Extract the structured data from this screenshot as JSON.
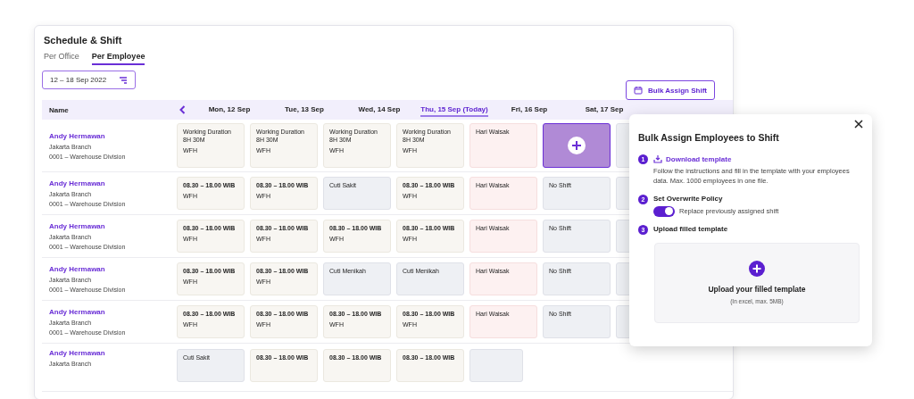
{
  "page": {
    "title": "Schedule & Shift"
  },
  "tabs": [
    {
      "label": "Per Office",
      "selected": false
    },
    {
      "label": "Per Employee",
      "selected": true
    }
  ],
  "date_filter": {
    "value": "12 – 18 Sep 2022"
  },
  "bulk_button": {
    "label": "Bulk Assign Shift"
  },
  "table": {
    "name_header": "Name",
    "days": [
      {
        "label": "Mon, 12 Sep",
        "selected": false
      },
      {
        "label": "Tue, 13 Sep",
        "selected": false
      },
      {
        "label": "Wed, 14 Sep",
        "selected": false
      },
      {
        "label": "Thu, 15 Sep (Today)",
        "selected": true
      },
      {
        "label": "Fri, 16 Sep",
        "selected": false
      },
      {
        "label": "Sat, 17 Sep",
        "selected": false
      }
    ],
    "rows": [
      {
        "name": "Andy Hermawan",
        "branch": "Jakarta Branch",
        "division": "0001 – Warehouse Division",
        "cells": [
          {
            "kind": "duration",
            "title": "Working Duration",
            "value": "8H 30M",
            "note": "WFH"
          },
          {
            "kind": "duration",
            "title": "Working Duration",
            "value": "8H 30M",
            "note": "WFH"
          },
          {
            "kind": "duration",
            "title": "Working Duration",
            "value": "8H 30M",
            "note": "WFH"
          },
          {
            "kind": "duration",
            "title": "Working Duration",
            "value": "8H 30M",
            "note": "WFH"
          },
          {
            "kind": "holiday",
            "title": "Hari Waisak"
          },
          {
            "kind": "add"
          }
        ]
      },
      {
        "name": "Andy Hermawan",
        "branch": "Jakarta Branch",
        "division": "0001 – Warehouse Division",
        "cells": [
          {
            "kind": "time",
            "title": "08.30 – 18.00 WIB",
            "note": "WFH"
          },
          {
            "kind": "time",
            "title": "08.30 – 18.00 WIB",
            "note": "WFH"
          },
          {
            "kind": "leave",
            "title": "Cuti Sakit"
          },
          {
            "kind": "time",
            "title": "08.30 – 18.00 WIB",
            "note": "WFH"
          },
          {
            "kind": "holiday",
            "title": "Hari Waisak"
          },
          {
            "kind": "noshift",
            "title": "No Shift"
          }
        ]
      },
      {
        "name": "Andy Hermawan",
        "branch": "Jakarta Branch",
        "division": "0001 – Warehouse Division",
        "cells": [
          {
            "kind": "time",
            "title": "08.30 – 18.00 WIB",
            "note": "WFH"
          },
          {
            "kind": "time",
            "title": "08.30 – 18.00 WIB",
            "note": "WFH"
          },
          {
            "kind": "time",
            "title": "08.30 – 18.00 WIB",
            "note": "WFH"
          },
          {
            "kind": "time",
            "title": "08.30 – 18.00 WIB",
            "note": "WFH"
          },
          {
            "kind": "holiday",
            "title": "Hari Waisak"
          },
          {
            "kind": "noshift",
            "title": "No Shift"
          }
        ]
      },
      {
        "name": "Andy Hermawan",
        "branch": "Jakarta Branch",
        "division": "0001 – Warehouse Division",
        "cells": [
          {
            "kind": "time",
            "title": "08.30 – 18.00 WIB",
            "note": "WFH"
          },
          {
            "kind": "time",
            "title": "08.30 – 18.00 WIB",
            "note": "WFH"
          },
          {
            "kind": "leave",
            "title": "Cuti Menikah"
          },
          {
            "kind": "leave",
            "title": "Cuti Menikah"
          },
          {
            "kind": "holiday",
            "title": "Hari Waisak"
          },
          {
            "kind": "noshift",
            "title": "No Shift"
          }
        ]
      },
      {
        "name": "Andy Hermawan",
        "branch": "Jakarta Branch",
        "division": "0001 – Warehouse Division",
        "cells": [
          {
            "kind": "time",
            "title": "08.30 – 18.00 WIB",
            "note": "WFH"
          },
          {
            "kind": "time",
            "title": "08.30 – 18.00 WIB",
            "note": "WFH"
          },
          {
            "kind": "time",
            "title": "08.30 – 18.00 WIB",
            "note": "WFH"
          },
          {
            "kind": "time",
            "title": "08.30 – 18.00 WIB",
            "note": "WFH"
          },
          {
            "kind": "holiday",
            "title": "Hari Waisak"
          },
          {
            "kind": "noshift",
            "title": "No Shift"
          }
        ]
      },
      {
        "name": "Andy Hermawan",
        "branch": "Jakarta Branch",
        "cells": [
          {
            "kind": "leave",
            "title": "Cuti Sakit"
          },
          {
            "kind": "time",
            "title": "08.30 – 18.00 WIB"
          },
          {
            "kind": "time",
            "title": "08.30 – 18.00 WIB"
          },
          {
            "kind": "time",
            "title": "08.30 – 18.00 WIB"
          }
        ]
      }
    ]
  },
  "dialog": {
    "title": "Bulk Assign Employees to Shift",
    "step_1": {
      "number": "1",
      "link": "Download template",
      "text": "Follow the instructions and fill in the template with your employees data. Max. 1000 employees in one file."
    },
    "step_2": {
      "number": "2",
      "label": "Set Overwrite Policy",
      "toggle": {
        "on": true,
        "label": "Replace previously assigned shift"
      }
    },
    "step_3": {
      "number": "3",
      "label": "Upload filled template"
    },
    "upload": {
      "title": "Upload your filled template",
      "hint": "(In excel, max. 5MB)"
    }
  }
}
